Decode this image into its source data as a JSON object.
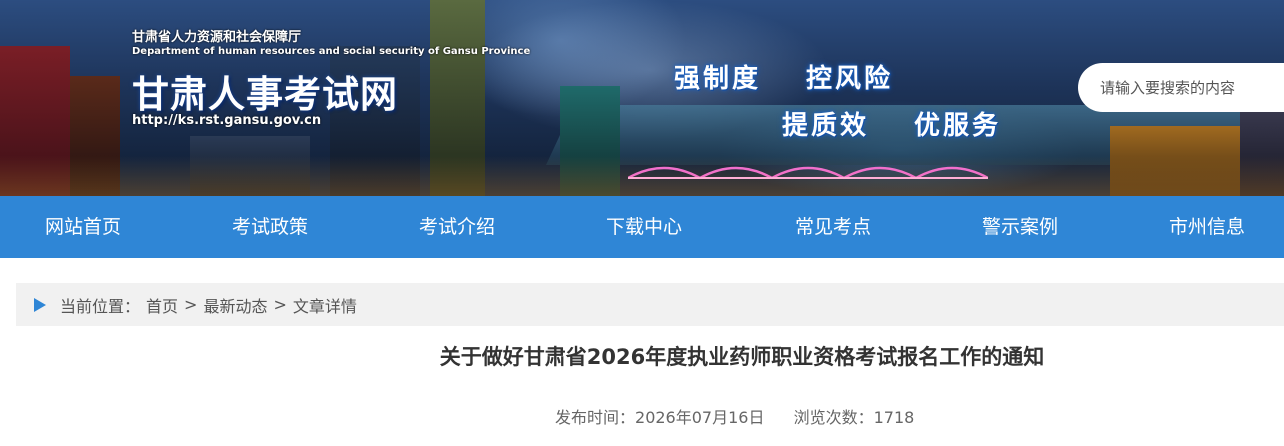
{
  "header": {
    "org_name": "甘肃省人力资源和社会保障厅",
    "org_name_en": "Department of human resources and social security of Gansu Province",
    "site_title": "甘肃人事考试网",
    "site_url": "http://ks.rst.gansu.gov.cn",
    "slogans": [
      "强制度",
      "控风险",
      "提质效",
      "优服务"
    ],
    "search": {
      "placeholder": "请输入要搜索的内容",
      "value": ""
    }
  },
  "nav": {
    "items": [
      {
        "label": "网站首页"
      },
      {
        "label": "考试政策"
      },
      {
        "label": "考试介绍"
      },
      {
        "label": "下载中心"
      },
      {
        "label": "常见考点"
      },
      {
        "label": "警示案例"
      },
      {
        "label": "市州信息"
      }
    ]
  },
  "breadcrumb": {
    "prefix": "当前位置：",
    "items": [
      "首页",
      "最新动态",
      "文章详情"
    ],
    "separator": ">"
  },
  "article": {
    "title": "关于做好甘肃省2026年度执业药师职业资格考试报名工作的通知",
    "publish_label": "发布时间：",
    "publish_date": "2026年07月16日",
    "views_label": "浏览次数：",
    "views": "1718"
  },
  "colors": {
    "nav_bg": "#2f86d6",
    "breadcrumb_bg": "#f1f1f1",
    "accent": "#2f86d6",
    "title_text": "#333333"
  }
}
